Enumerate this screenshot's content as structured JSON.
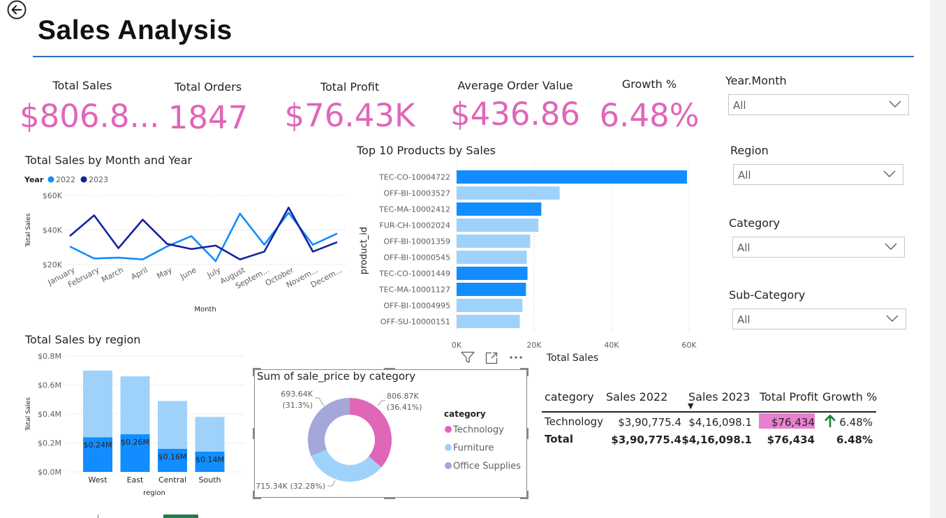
{
  "page": {
    "title": "Sales Analysis"
  },
  "icons": {
    "back": "arrow-left-circle-icon",
    "filter": "filter-icon",
    "focus": "focus-mode-icon",
    "more": "more-options-icon",
    "chevron": "chevron-down-icon",
    "growth": "arrow-up-icon"
  },
  "colors": {
    "kpi": "#e066b8",
    "series_2022": "#118dff",
    "series_2023": "#12239e",
    "light_bar": "#9fd2fb",
    "dark_bar": "#118dff",
    "rule": "#2a6fbf"
  },
  "kpis": [
    {
      "label": "Total Sales",
      "value": "$806.8..."
    },
    {
      "label": "Total Orders",
      "value": "1847"
    },
    {
      "label": "Total Profit",
      "value": "$76.43K"
    },
    {
      "label": "Average Order Value",
      "value": "$436.86"
    },
    {
      "label": "Growth %",
      "value": "6.48%"
    }
  ],
  "slicers": [
    {
      "label": "Year.Month",
      "value": "All"
    },
    {
      "label": "Region",
      "value": "All"
    },
    {
      "label": "Category",
      "value": "All"
    },
    {
      "label": "Sub-Category",
      "value": "All"
    }
  ],
  "visual_tools": {
    "filter": "filter",
    "focus": "focus mode",
    "more": "..."
  },
  "line_chart": {
    "title": "Total Sales by Month and Year",
    "legend_title": "Year",
    "ylabel": "Total Sales",
    "xlabel": "Month",
    "chart_data": {
      "type": "line",
      "categories": [
        "January",
        "February",
        "March",
        "April",
        "May",
        "June",
        "July",
        "August",
        "Septem...",
        "October",
        "Novem...",
        "Decem..."
      ],
      "ylim": [
        20000,
        60000
      ],
      "yticks": [
        "$20K",
        "$40K",
        "$60K"
      ],
      "ytick_values": [
        20000,
        40000,
        60000
      ],
      "series": [
        {
          "name": "2022",
          "color": "#118dff",
          "values": [
            30500,
            23500,
            24000,
            23000,
            30500,
            36500,
            22000,
            49500,
            31500,
            50000,
            31500,
            38000
          ]
        },
        {
          "name": "2023",
          "color": "#12239e",
          "values": [
            36500,
            48500,
            29500,
            46000,
            32000,
            29000,
            31000,
            23000,
            27500,
            53000,
            27500,
            33000
          ]
        }
      ],
      "grid": true,
      "legend": "top-left"
    }
  },
  "top_products": {
    "title": "Top 10 Products by Sales",
    "ylabel": "product_id",
    "xlabel": "Total Sales",
    "chart_data": {
      "type": "bar",
      "orientation": "horizontal",
      "categories": [
        "TEC-CO-10004722",
        "OFF-BI-10003527",
        "TEC-MA-10002412",
        "FUR-CH-10002024",
        "OFF-BI-10001359",
        "OFF-BI-10000545",
        "TEC-CO-10001449",
        "TEC-MA-10001127",
        "OFF-BI-10004995",
        "OFF-SU-10000151"
      ],
      "values": [
        59450,
        26600,
        21870,
        21100,
        19000,
        18100,
        18300,
        17900,
        17000,
        16300
      ],
      "bar_colors": [
        "#118dff",
        "#9fd2fb",
        "#118dff",
        "#9fd2fb",
        "#9fd2fb",
        "#9fd2fb",
        "#118dff",
        "#118dff",
        "#9fd2fb",
        "#9fd2fb"
      ],
      "xlim": [
        0,
        60000
      ],
      "xticks": [
        "0K",
        "20K",
        "40K",
        "60K"
      ],
      "xtick_values": [
        0,
        20000,
        40000,
        60000
      ],
      "grid": true
    }
  },
  "region_chart": {
    "title": "Total Sales by region",
    "ylabel": "Total Sales",
    "xlabel": "region",
    "chart_data": {
      "type": "bar",
      "stacked": true,
      "categories": [
        "West",
        "East",
        "Central",
        "South"
      ],
      "ylim": [
        0,
        0.8
      ],
      "yticks": [
        "$0.0M",
        "$0.2M",
        "$0.4M",
        "$0.6M",
        "$0.8M"
      ],
      "ytick_values": [
        0,
        0.2,
        0.4,
        0.6,
        0.8
      ],
      "series": [
        {
          "color": "#118dff",
          "values": [
            0.24,
            0.26,
            0.16,
            0.14
          ],
          "labels": [
            "$0.24M",
            "$0.26M",
            "$0.16M",
            "$0.14M"
          ]
        },
        {
          "color": "#9fd2fb",
          "values": [
            0.46,
            0.4,
            0.33,
            0.24
          ]
        }
      ],
      "grid": true
    }
  },
  "donut_chart": {
    "title": "Sum of sale_price by category",
    "legend_title": "category",
    "chart_data": {
      "type": "pie",
      "donut": true,
      "categories": [
        "Technology",
        "Furniture",
        "Office Supplies"
      ],
      "values": [
        806.87,
        715.34,
        693.64
      ],
      "percents": [
        36.41,
        32.28,
        31.3
      ],
      "colors": [
        "#e066b8",
        "#9fd2fb",
        "#a4a7d8"
      ],
      "labels": [
        {
          "value": "806.87K",
          "pct": "(36.41%)"
        },
        {
          "value": "715.34K (32.28%)"
        },
        {
          "value": "693.64K",
          "pct": "(31.3%)"
        }
      ],
      "legend": "right"
    }
  },
  "table": {
    "headers": [
      "category",
      "Sales 2022",
      "Sales 2023",
      "Total Profit",
      "Growth %"
    ],
    "sort_indicator": "▼",
    "rows": [
      {
        "category": "Technology",
        "sales_2022": "$3,90,775.4",
        "sales_2023": "$4,16,098.1",
        "profit": "$76,434",
        "growth": "6.48%"
      }
    ],
    "total": {
      "category": "Total",
      "sales_2022": "$3,90,775.4",
      "sales_2023": "$4,16,098.1",
      "profit": "$76,434",
      "growth": "6.48%"
    },
    "profit_highlight": "#e97fcf",
    "growth_arrow_color": "#1e7e34"
  }
}
